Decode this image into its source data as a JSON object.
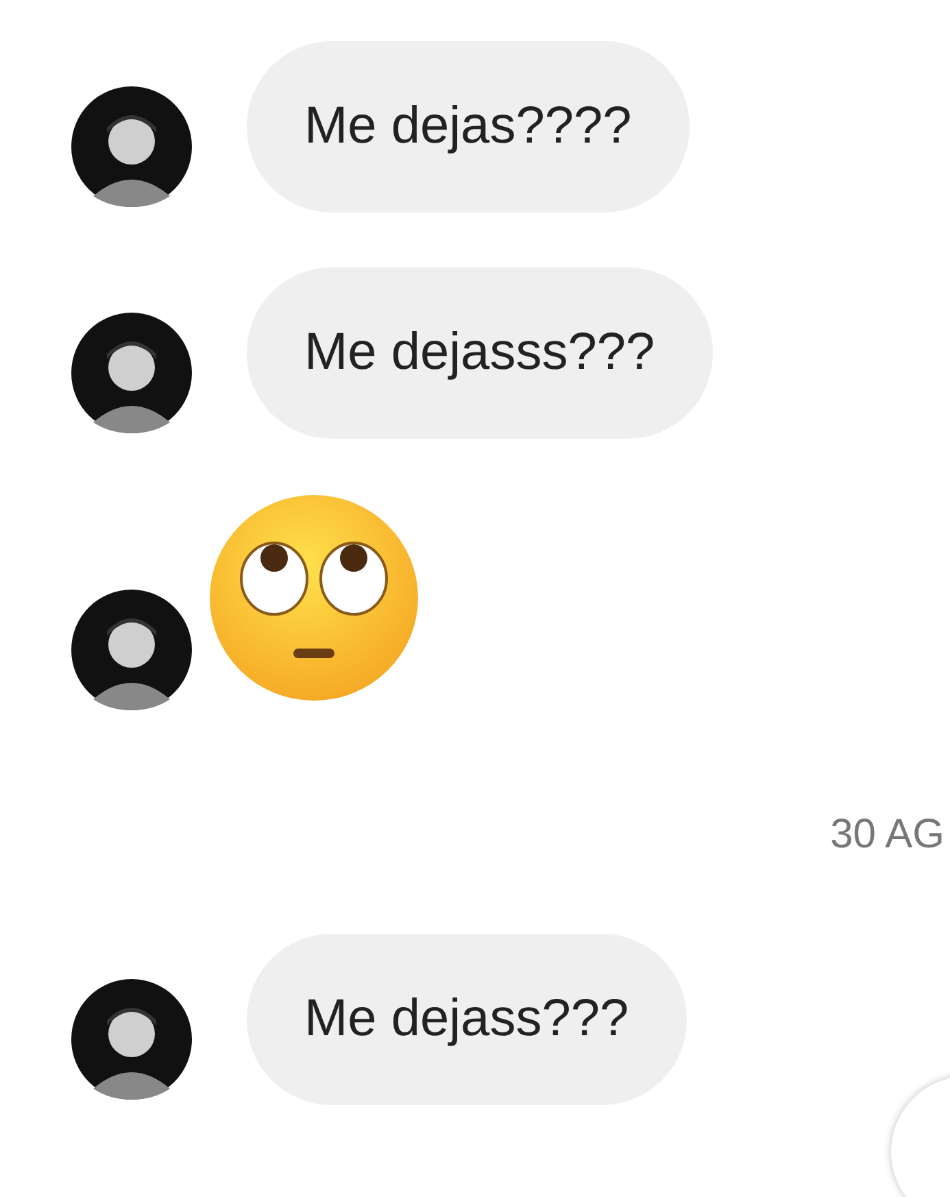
{
  "chat": [
    {
      "kind": "message",
      "text": "Me dejas????"
    },
    {
      "kind": "message",
      "text": "Me dejasss???"
    },
    {
      "kind": "emoji"
    },
    {
      "kind": "timestamp",
      "text": "30 AG"
    },
    {
      "kind": "message",
      "text": "Me dejass???"
    }
  ]
}
